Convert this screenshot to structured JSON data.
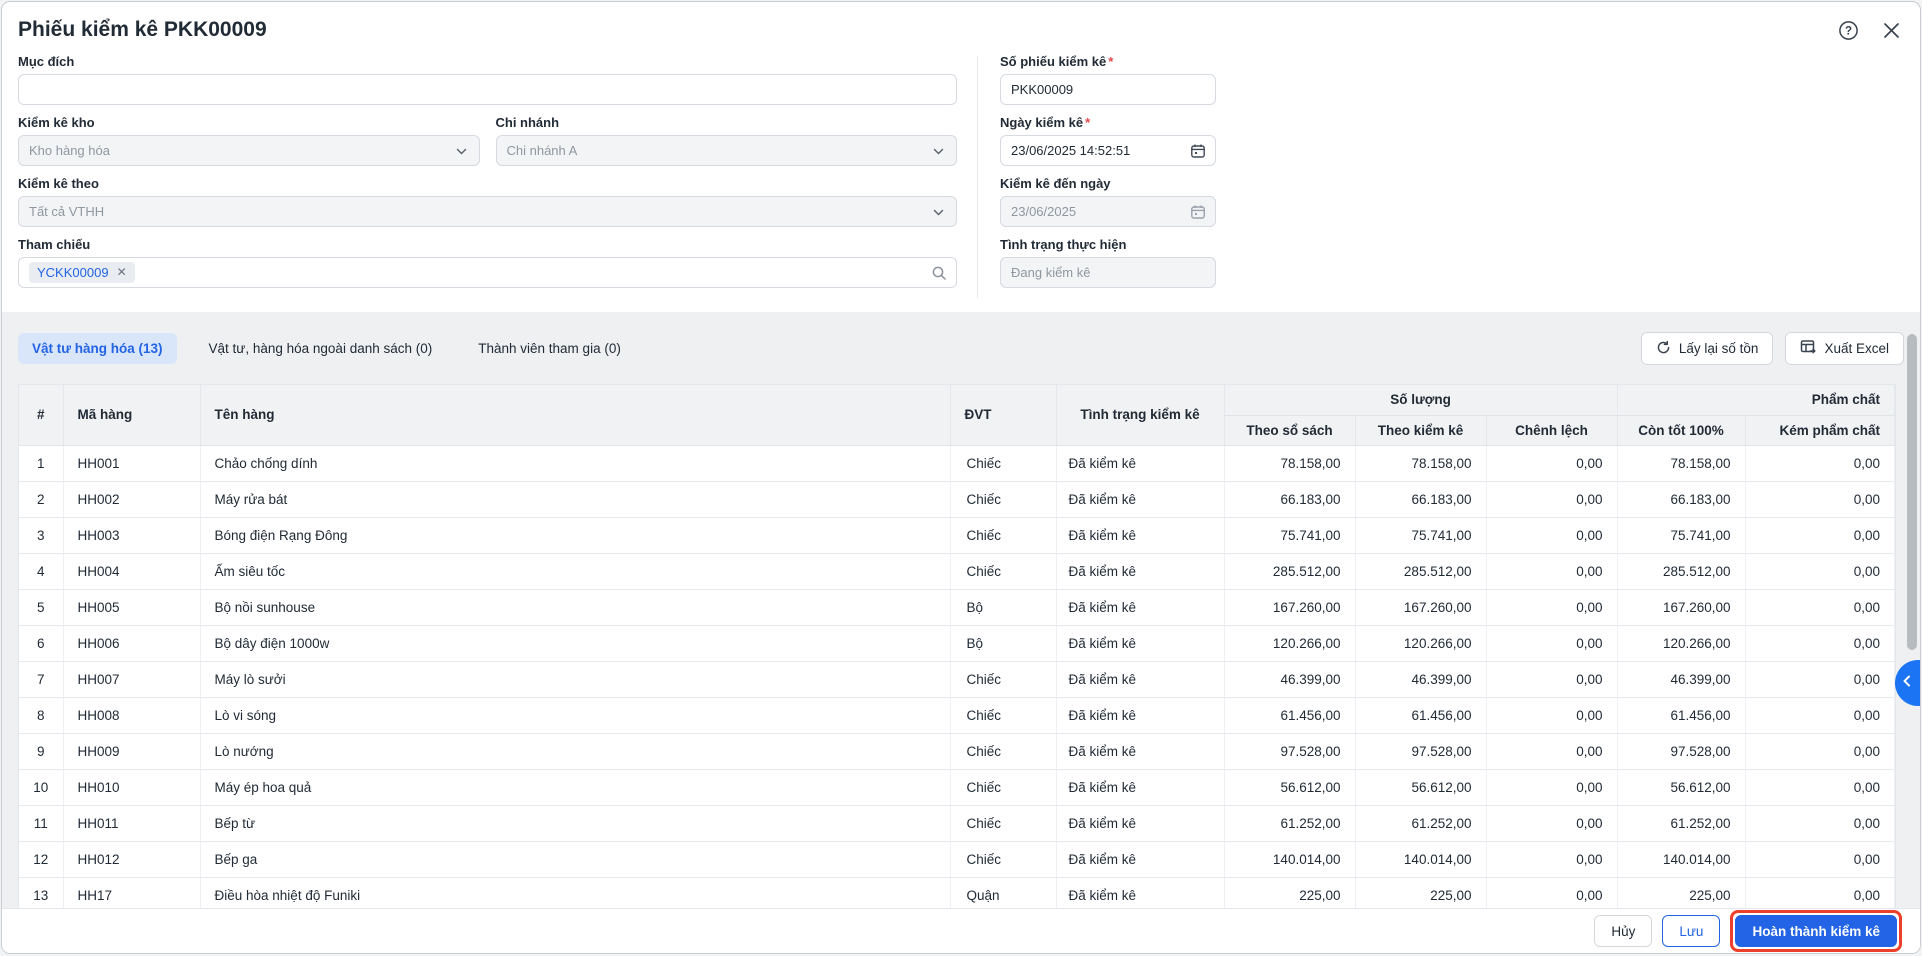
{
  "window": {
    "title": "Phiếu kiểm kê PKK00009"
  },
  "form": {
    "required_mark": "*",
    "muc_dich": {
      "label": "Mục đích",
      "value": ""
    },
    "kiem_ke_kho": {
      "label": "Kiểm kê kho",
      "value": "Kho hàng hóa"
    },
    "chi_nhanh": {
      "label": "Chi nhánh",
      "value": "Chi nhánh A"
    },
    "kiem_ke_theo": {
      "label": "Kiểm kê theo",
      "value": "Tất cả VTHH"
    },
    "tham_chieu": {
      "label": "Tham chiếu",
      "tag": "YCKK00009"
    },
    "so_phieu_kiem_ke": {
      "label": "Số phiếu kiểm kê",
      "value": "PKK00009"
    },
    "ngay_kiem_ke": {
      "label": "Ngày kiểm kê",
      "value": "23/06/2025 14:52:51"
    },
    "kiem_ke_den_ngay": {
      "label": "Kiểm kê đến ngày",
      "value": "23/06/2025"
    },
    "tinh_trang_thuc_hien": {
      "label": "Tình trạng thực hiện",
      "value": "Đang kiểm kê"
    }
  },
  "tabs": [
    {
      "label": "Vật tư hàng hóa (13)",
      "active": true
    },
    {
      "label": "Vật tư, hàng hóa ngoài danh sách (0)",
      "active": false
    },
    {
      "label": "Thành viên tham gia (0)",
      "active": false
    }
  ],
  "toolbar": {
    "refresh_label": "Lấy lại số tồn",
    "export_label": "Xuất Excel"
  },
  "table": {
    "columns": {
      "index": "#",
      "code": "Mã hàng",
      "name": "Tên hàng",
      "unit": "ĐVT",
      "status": "Tình trạng kiểm kê",
      "qty_group": "Số lượng",
      "quality_group": "Phẩm chất",
      "by_book": "Theo sổ sách",
      "by_count": "Theo kiểm kê",
      "difference": "Chênh lệch",
      "good": "Còn tốt 100%",
      "bad": "Kém phẩm chất"
    },
    "rows": [
      [
        "1",
        "HH001",
        "Chảo chống dính",
        "Chiếc",
        "Đã kiểm kê",
        "78.158,00",
        "78.158,00",
        "0,00",
        "78.158,00",
        "0,00"
      ],
      [
        "2",
        "HH002",
        "Máy rửa bát",
        "Chiếc",
        "Đã kiểm kê",
        "66.183,00",
        "66.183,00",
        "0,00",
        "66.183,00",
        "0,00"
      ],
      [
        "3",
        "HH003",
        "Bóng điện Rạng Đông",
        "Chiếc",
        "Đã kiểm kê",
        "75.741,00",
        "75.741,00",
        "0,00",
        "75.741,00",
        "0,00"
      ],
      [
        "4",
        "HH004",
        "Ấm siêu tốc",
        "Chiếc",
        "Đã kiểm kê",
        "285.512,00",
        "285.512,00",
        "0,00",
        "285.512,00",
        "0,00"
      ],
      [
        "5",
        "HH005",
        "Bộ nồi sunhouse",
        "Bộ",
        "Đã kiểm kê",
        "167.260,00",
        "167.260,00",
        "0,00",
        "167.260,00",
        "0,00"
      ],
      [
        "6",
        "HH006",
        "Bộ dây điện 1000w",
        "Bộ",
        "Đã kiểm kê",
        "120.266,00",
        "120.266,00",
        "0,00",
        "120.266,00",
        "0,00"
      ],
      [
        "7",
        "HH007",
        "Máy lò sưởi",
        "Chiếc",
        "Đã kiểm kê",
        "46.399,00",
        "46.399,00",
        "0,00",
        "46.399,00",
        "0,00"
      ],
      [
        "8",
        "HH008",
        "Lò vi sóng",
        "Chiếc",
        "Đã kiểm kê",
        "61.456,00",
        "61.456,00",
        "0,00",
        "61.456,00",
        "0,00"
      ],
      [
        "9",
        "HH009",
        "Lò nướng",
        "Chiếc",
        "Đã kiểm kê",
        "97.528,00",
        "97.528,00",
        "0,00",
        "97.528,00",
        "0,00"
      ],
      [
        "10",
        "HH010",
        "Máy ép hoa quả",
        "Chiếc",
        "Đã kiểm kê",
        "56.612,00",
        "56.612,00",
        "0,00",
        "56.612,00",
        "0,00"
      ],
      [
        "11",
        "HH011",
        "Bếp từ",
        "Chiếc",
        "Đã kiểm kê",
        "61.252,00",
        "61.252,00",
        "0,00",
        "61.252,00",
        "0,00"
      ],
      [
        "12",
        "HH012",
        "Bếp ga",
        "Chiếc",
        "Đã kiểm kê",
        "140.014,00",
        "140.014,00",
        "0,00",
        "140.014,00",
        "0,00"
      ],
      [
        "13",
        "HH17",
        "Điều hòa nhiệt độ Funiki",
        "Quận",
        "Đã kiểm kê",
        "225,00",
        "225,00",
        "0,00",
        "225,00",
        "0,00"
      ]
    ]
  },
  "footer": {
    "cancel_label": "Hủy",
    "save_label": "Lưu",
    "complete_label": "Hoàn thành kiểm kê"
  },
  "colors": {
    "primary": "#2264e5",
    "active_tab_bg": "#d9e6fa",
    "annotation_red": "#ee3f2d",
    "handle_blue": "#1b74f3"
  }
}
